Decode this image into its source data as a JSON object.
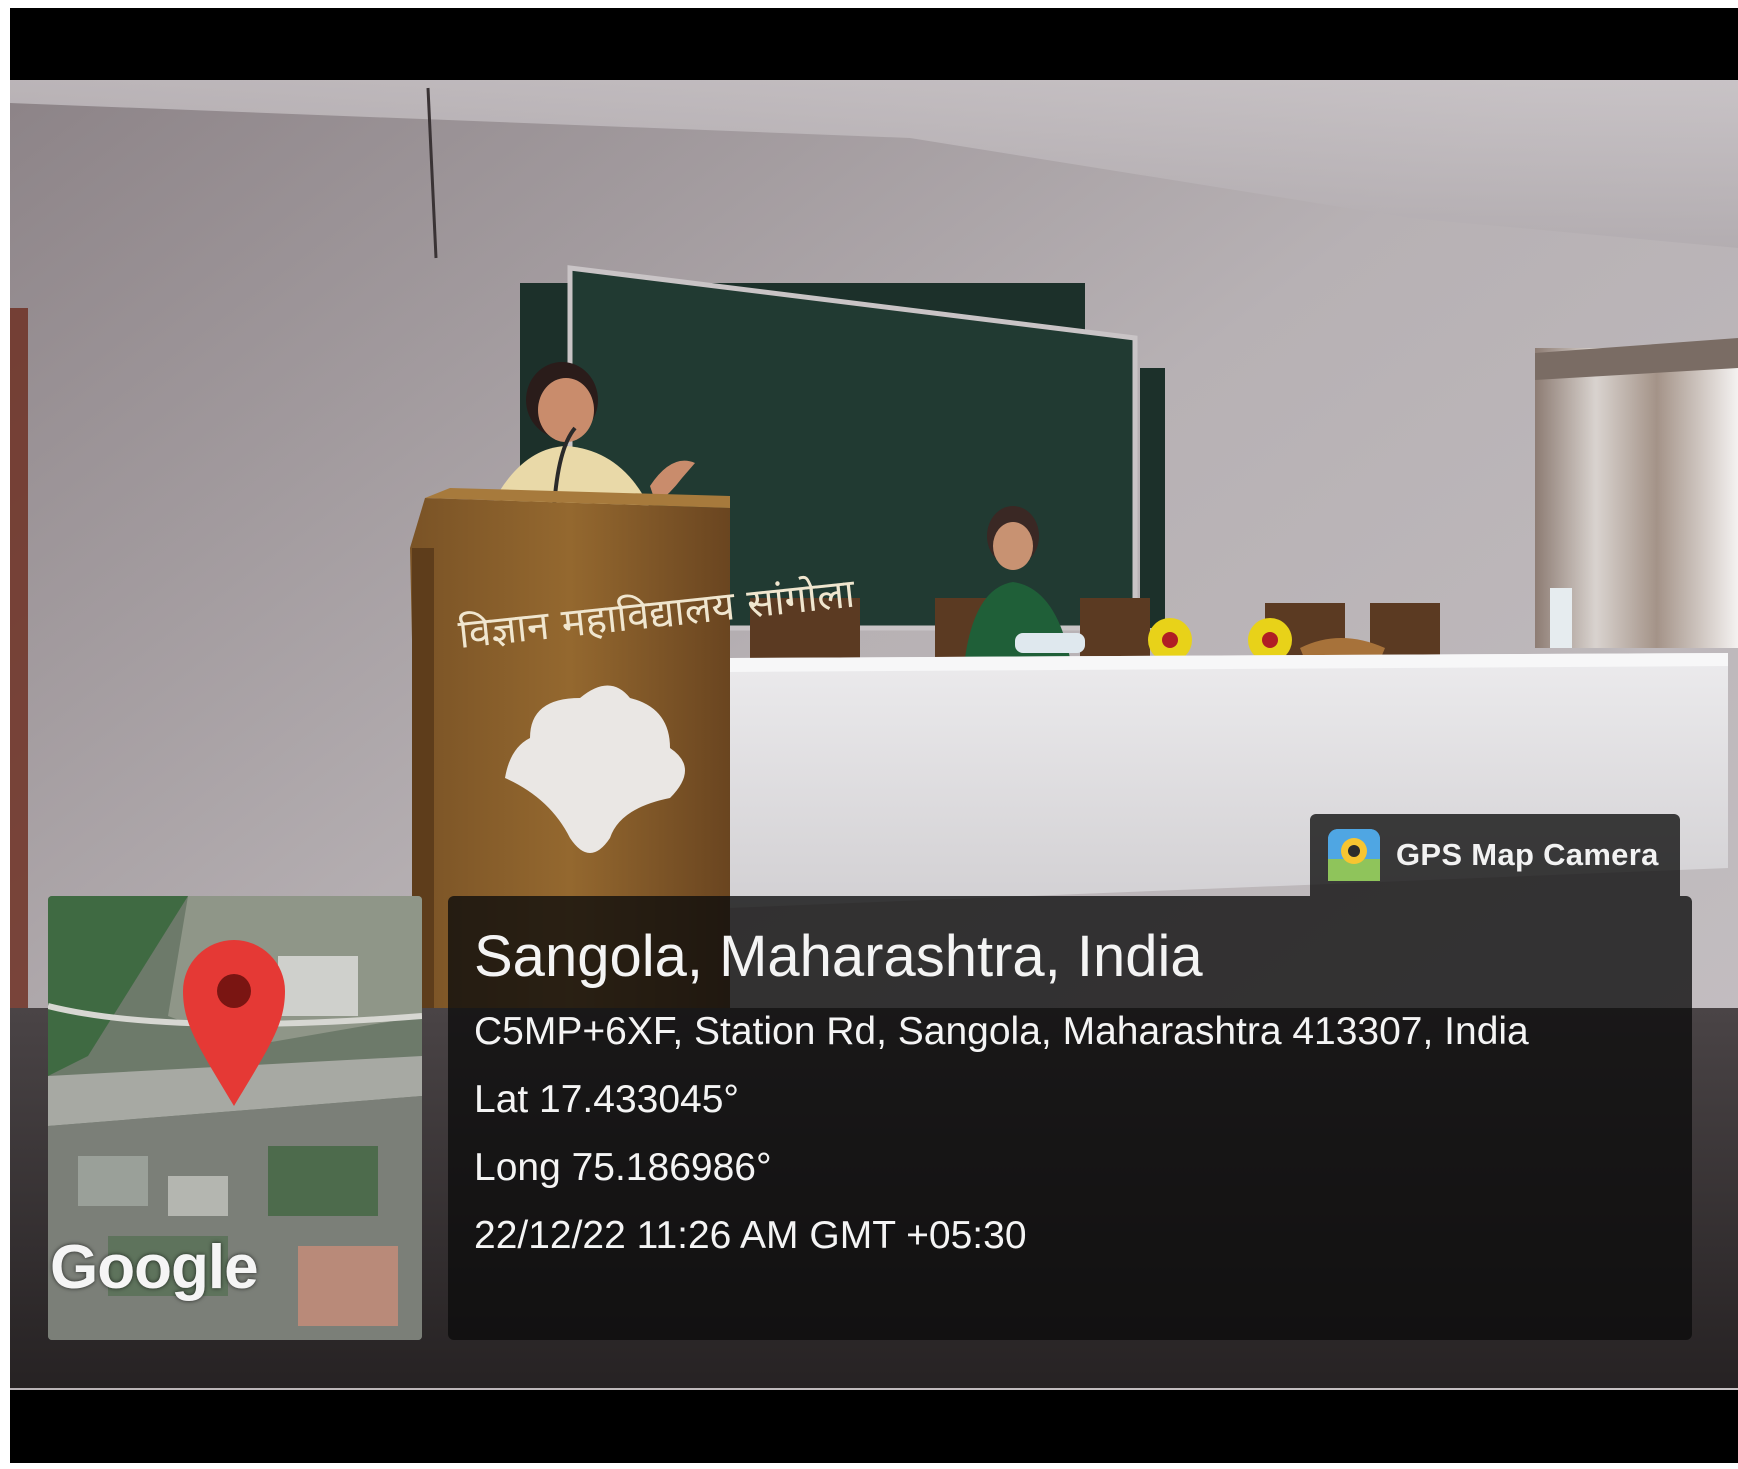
{
  "brand": {
    "name": "GPS Map Camera",
    "icon": "gps-map-camera-app-icon"
  },
  "location": {
    "title": "Sangola, Maharashtra, India",
    "address": "C5MP+6XF, Station Rd, Sangola, Maharashtra 413307, India",
    "latitude": "Lat 17.433045°",
    "longitude": "Long 75.186986°",
    "datetime": "22/12/22 11:26 AM GMT +05:30"
  },
  "minimap": {
    "attribution": "Google",
    "marker": "location-pin-icon",
    "pin_color": "#e53935"
  },
  "photo": {
    "podium_text": "विज्ञान महाविद्यालय सांगोला"
  },
  "colors": {
    "overlay": "#0c0c0c",
    "text": "#f4f4f4",
    "board": "#213a32",
    "wall": "#b9b3b6"
  }
}
